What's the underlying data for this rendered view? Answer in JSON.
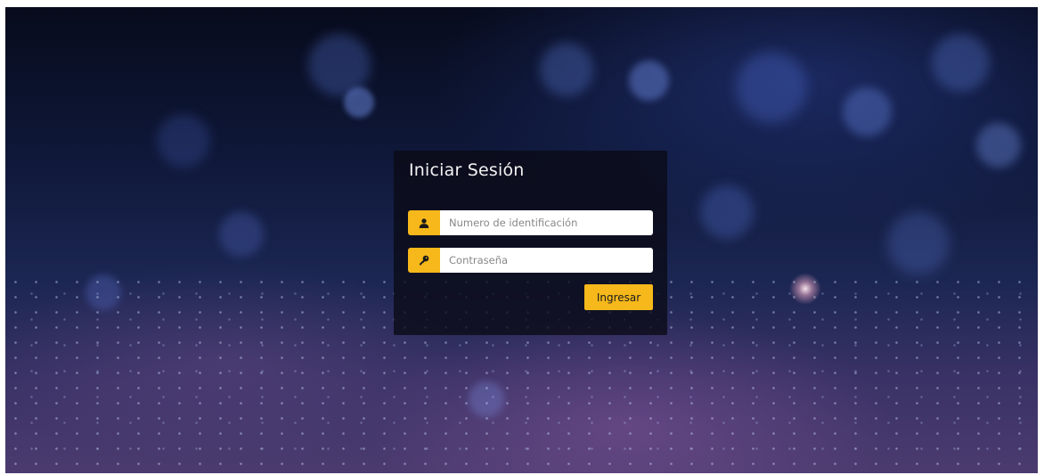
{
  "login": {
    "title": "Iniciar Sesión",
    "id_field": {
      "placeholder": "Numero de identificación",
      "value": "",
      "icon": "user-icon"
    },
    "password_field": {
      "placeholder": "Contraseña",
      "value": "",
      "icon": "key-icon"
    },
    "submit_label": "Ingresar"
  },
  "colors": {
    "accent": "#f6b81a",
    "panel": "#0a0a16",
    "title_text": "#f2f2f2"
  }
}
